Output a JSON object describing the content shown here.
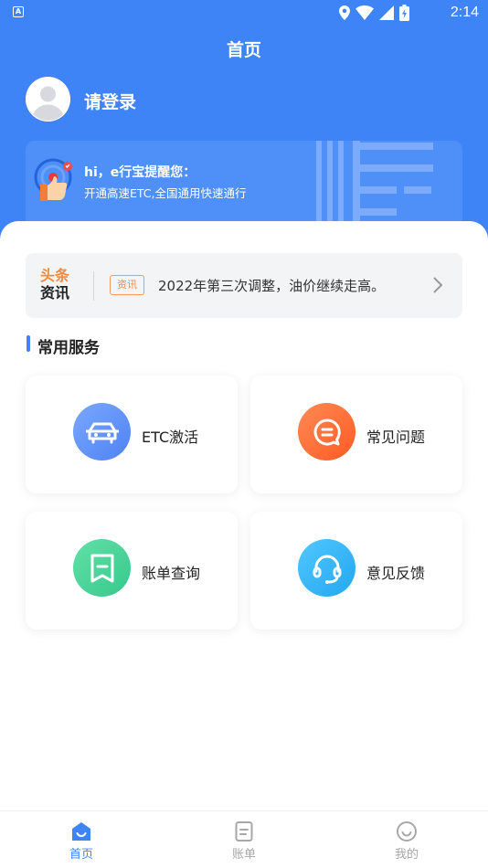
{
  "status_bar": {
    "app_indicator": "A",
    "time": "2:14"
  },
  "header": {
    "title": "首页"
  },
  "user": {
    "login_prompt": "请登录"
  },
  "banner": {
    "title": "hi，e行宝提醒您：",
    "subtitle": "开通高速ETC,全国通用快速通行"
  },
  "news": {
    "logo_top": "头条",
    "logo_bottom": "资讯",
    "tag": "资讯",
    "text": "2022年第三次调整，油价继续走高。"
  },
  "services": {
    "title": "常用服务",
    "items": [
      {
        "label": "ETC激活",
        "icon": "car-icon"
      },
      {
        "label": "常见问题",
        "icon": "chat-icon"
      },
      {
        "label": "账单查询",
        "icon": "bill-icon"
      },
      {
        "label": "意见反馈",
        "icon": "headset-icon"
      }
    ]
  },
  "tabbar": {
    "items": [
      {
        "label": "首页",
        "icon": "home-icon",
        "active": true
      },
      {
        "label": "账单",
        "icon": "bill-tab-icon",
        "active": false
      },
      {
        "label": "我的",
        "icon": "smile-icon",
        "active": false
      }
    ]
  },
  "colors": {
    "primary": "#3f84f6",
    "etc": "#5b8ef6",
    "faq": "#ff6a33",
    "bill": "#3fcf95",
    "feedback": "#2fb4f5",
    "news_tag": "#f08a47"
  }
}
